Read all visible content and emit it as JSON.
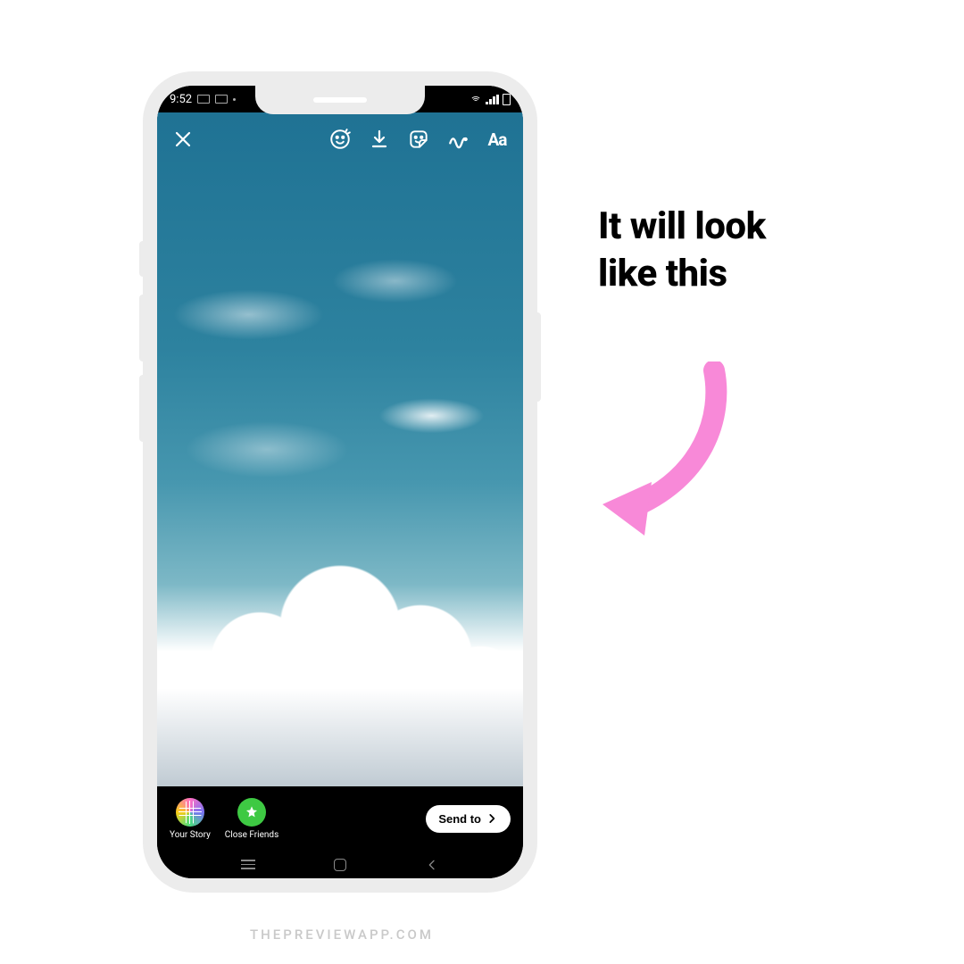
{
  "annotation": {
    "line1": "It will look",
    "line2": "like this"
  },
  "watermark": "THEPREVIEWAPP.COM",
  "status_bar": {
    "time": "9:52"
  },
  "story_toolbar": {
    "close": "close",
    "effects": "face-effects",
    "download": "download",
    "sticker": "sticker",
    "draw": "draw",
    "text_label": "Aa"
  },
  "share_bar": {
    "your_story": "Your Story",
    "close_friends": "Close Friends",
    "send_to": "Send to"
  },
  "colors": {
    "arrow": "#f889d8",
    "close_friends_green": "#3ec943"
  }
}
